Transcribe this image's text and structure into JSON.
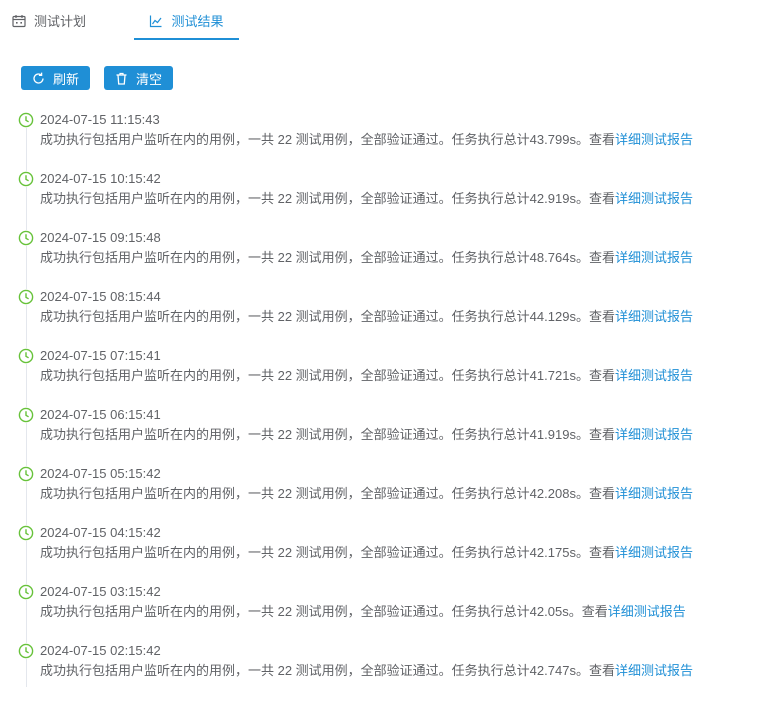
{
  "tabs": [
    {
      "label": "测试计划",
      "icon": "calendar-icon"
    },
    {
      "label": "测试结果",
      "icon": "line-chart-icon"
    }
  ],
  "toolbar": {
    "refresh_label": "刷新",
    "clear_label": "清空"
  },
  "colors": {
    "accent": "#1f8fd6",
    "success": "#67c23a"
  },
  "timeline": [
    {
      "time": "2024-07-15 11:15:43",
      "message": "成功执行包括用户监听在内的用例，一共 22 测试用例，全部验证通过。任务执行总计43.799s。查看",
      "link": "详细测试报告"
    },
    {
      "time": "2024-07-15 10:15:42",
      "message": "成功执行包括用户监听在内的用例，一共 22 测试用例，全部验证通过。任务执行总计42.919s。查看",
      "link": "详细测试报告"
    },
    {
      "time": "2024-07-15 09:15:48",
      "message": "成功执行包括用户监听在内的用例，一共 22 测试用例，全部验证通过。任务执行总计48.764s。查看",
      "link": "详细测试报告"
    },
    {
      "time": "2024-07-15 08:15:44",
      "message": "成功执行包括用户监听在内的用例，一共 22 测试用例，全部验证通过。任务执行总计44.129s。查看",
      "link": "详细测试报告"
    },
    {
      "time": "2024-07-15 07:15:41",
      "message": "成功执行包括用户监听在内的用例，一共 22 测试用例，全部验证通过。任务执行总计41.721s。查看",
      "link": "详细测试报告"
    },
    {
      "time": "2024-07-15 06:15:41",
      "message": "成功执行包括用户监听在内的用例，一共 22 测试用例，全部验证通过。任务执行总计41.919s。查看",
      "link": "详细测试报告"
    },
    {
      "time": "2024-07-15 05:15:42",
      "message": "成功执行包括用户监听在内的用例，一共 22 测试用例，全部验证通过。任务执行总计42.208s。查看",
      "link": "详细测试报告"
    },
    {
      "time": "2024-07-15 04:15:42",
      "message": "成功执行包括用户监听在内的用例，一共 22 测试用例，全部验证通过。任务执行总计42.175s。查看",
      "link": "详细测试报告"
    },
    {
      "time": "2024-07-15 03:15:42",
      "message": "成功执行包括用户监听在内的用例，一共 22 测试用例，全部验证通过。任务执行总计42.05s。查看",
      "link": "详细测试报告"
    },
    {
      "time": "2024-07-15 02:15:42",
      "message": "成功执行包括用户监听在内的用例，一共 22 测试用例，全部验证通过。任务执行总计42.747s。查看",
      "link": "详细测试报告"
    }
  ]
}
